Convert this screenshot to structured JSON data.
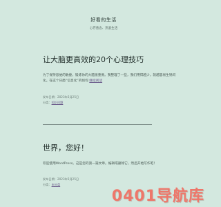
{
  "site": {
    "title": "好看的生活",
    "tagline": "心存善念、热爱生活"
  },
  "posts": [
    {
      "title": "让大脑更高效的20个心理技巧",
      "excerpt": "为了保持思维的敏捷，锻炼你的大脑很重要。我整理了一些，我们用得越少，就越容易生锈闷化。在这个日趋“信息化”的如何",
      "read_more": "继续阅读",
      "date_label": "发布日期：",
      "date": "2023年5月25日",
      "category_label": "分类：",
      "category": "知识问题"
    },
    {
      "title": "世界，您好！",
      "excerpt": "欢迎使用WordPress。这是您的第一篇文章。编辑或删除它，然后开始写作吧！",
      "date_label": "发布日期：",
      "date": "2023年5月25日",
      "category_label": "分类：",
      "category": "未分类"
    }
  ],
  "watermark": {
    "text": "0401导航库",
    "color": "#f26b5e"
  }
}
